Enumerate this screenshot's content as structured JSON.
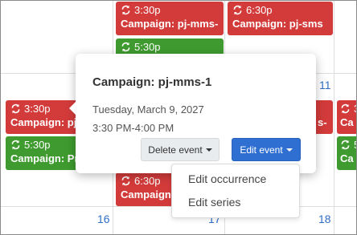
{
  "calendar": {
    "day_numbers": {
      "d11": "11",
      "d16": "16",
      "d17": "17",
      "d18": "18"
    },
    "events": {
      "top_left": {
        "time": "3:30p",
        "title": "Campaign: pj-mms-"
      },
      "top_right": {
        "time": "6:30p",
        "title": "Campaign: pj-sms"
      },
      "top_green": {
        "time": "5:30p"
      },
      "mid_left": {
        "time": "3:30p",
        "title": "Campaign: pj"
      },
      "mid_green": {
        "time": "5:30p",
        "title": "Campaign: Pr"
      },
      "mid_right_partial": {
        "title": "s-"
      },
      "far_right": {
        "time": "3",
        "title": "Ca"
      },
      "far_right2": {
        "time": "5",
        "title": "Ca"
      },
      "low": {
        "time": "6:30p",
        "title": "Campaign"
      }
    }
  },
  "popover": {
    "title": "Campaign: pj-mms-1",
    "date": "Tuesday, March 9, 2027",
    "time": "3:30 PM-4:00 PM",
    "delete_label": "Delete event",
    "edit_label": "Edit event"
  },
  "edit_menu": {
    "items": [
      "Edit occurrence",
      "Edit series"
    ]
  },
  "colors": {
    "red": "#d33b3b",
    "green": "#3f9b2f",
    "primary": "#2f6fd1",
    "link": "#2f6fc6"
  },
  "icons": {
    "recurring": "repeat-icon"
  }
}
